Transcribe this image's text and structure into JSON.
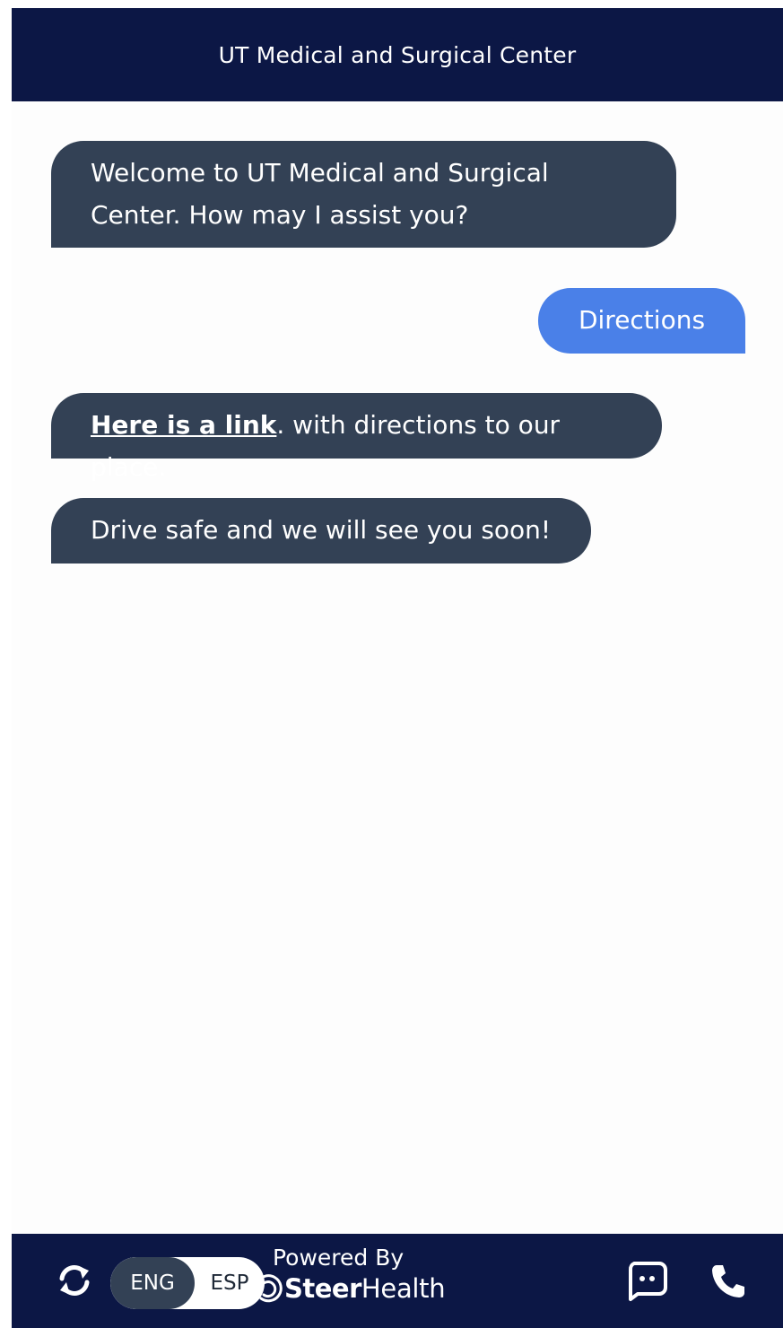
{
  "header": {
    "title": "UT Medical and Surgical Center"
  },
  "messages": [
    {
      "sender": "bot",
      "text": "Welcome to UT Medical and Surgical Center. How may I assist you?"
    },
    {
      "sender": "user",
      "text": "Directions"
    },
    {
      "sender": "bot",
      "link_text": "Here is a link",
      "text_after_link": ". with directions to our place."
    },
    {
      "sender": "bot",
      "text": "Drive safe and we will see you soon!"
    }
  ],
  "footer": {
    "refresh_icon": "refresh-icon",
    "language_toggle": {
      "options": [
        "ENG",
        "ESP"
      ],
      "selected": "ENG"
    },
    "powered_by": "Powered By",
    "brand_primary": "Steer",
    "brand_secondary": "Health",
    "chat_icon": "chat-bubble-icon",
    "phone_icon": "phone-icon"
  },
  "colors": {
    "header_bg": "#0c1745",
    "bot_bubble": "#334155",
    "user_bubble": "#4a80e8",
    "background": "#fdfdfd"
  }
}
